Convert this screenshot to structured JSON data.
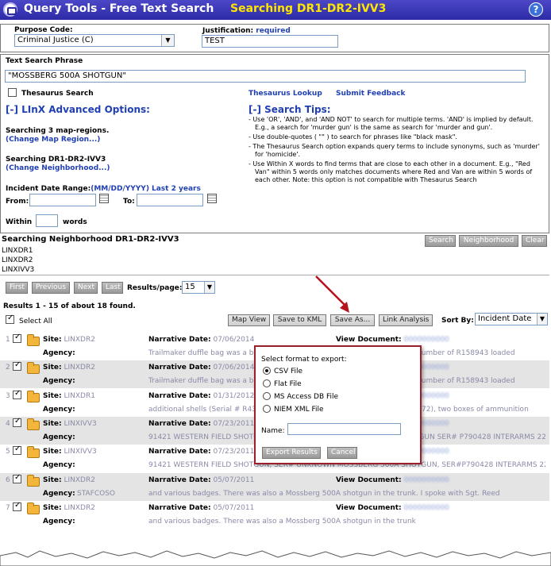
{
  "window": {
    "title": "Query Tools - Free Text Search",
    "subtitle": "Searching DR1-DR2-IVV3",
    "help": "?"
  },
  "form": {
    "purpose_label": "Purpose Code:",
    "purpose_value": "Criminal Justice (C)",
    "justification_label": "Justification:",
    "justification_required": "required",
    "justification_value": "TEST",
    "phrase_label": "Text Search Phrase",
    "phrase_value": "\"MOSSBERG 500A SHOTGUN\"",
    "thesaurus_label": "Thesaurus Search",
    "thesaurus_lookup": "Thesaurus Lookup",
    "submit_feedback": "Submit Feedback",
    "advanced_heading": "[-] LInX Advanced Options:",
    "tips_heading": "[-] Search Tips:",
    "map_regions_text": "Searching 3 map-regions.",
    "change_map_region": "(Change Map Region...)",
    "neighborhood_text": "Searching DR1-DR2-IVV3",
    "change_neighborhood": "(Change Neighborhood...)",
    "date_range_label": "Incident Date Range:",
    "date_format": "(MM/DD/YYYY)",
    "last_2_years": "Last 2 years",
    "from_label": "From:",
    "to_label": "To:",
    "within_label": "Within",
    "words_label": "words",
    "tips": [
      "- Use 'OR', 'AND', and 'AND NOT' to search for multiple terms. 'AND' is implied by default. E.g., a search for 'murder gun' is the same as search for 'murder and gun'.",
      "- Use double-quotes ( \"\" ) to search for phrases like \"black mask\".",
      "- The Thesaurus Search option expands query terms to include synonyms, such as 'murder' for 'homicide'.",
      "- Use Within X words to find terms that are close to each other in a document. E.g., \"Red Van\" within 5 words only matches documents where Red and Van are within 5 words of each other. Note: this option is not compatible with Thesaurus Search"
    ]
  },
  "neighborhood": {
    "heading": "Searching Neighborhood DR1-DR2-IVV3",
    "items": [
      "LINXDR1",
      "LINXDR2",
      "LINXIVV3"
    ],
    "search_btn": "Search",
    "neighborhood_btn": "Neighborhood",
    "clear_btn": "Clear"
  },
  "paging": {
    "first": "First",
    "previous": "Previous",
    "next": "Next",
    "last": "Last",
    "results_per_page_label": "Results/page:",
    "results_per_page": "15",
    "summary": "Results 1 - 15 of about 18 found.",
    "select_all": "Select All",
    "map_view": "Map View",
    "save_kml": "Save to KML",
    "save_as": "Save As...",
    "link_analysis": "Link Analysis",
    "sort_by_label": "Sort By:",
    "sort_by_value": "Incident Date"
  },
  "results": [
    {
      "num": "1",
      "site": "LINXDR2",
      "date": "07/06/2014",
      "agency": "",
      "narrative": "Trailmaker duffle bag was a black Mossberg 500A shotgun bearing a serial number of R158943 loaded"
    },
    {
      "num": "2",
      "site": "LINXDR2",
      "date": "07/06/2014",
      "agency": "",
      "narrative": "Trailmaker duffle bag was a black Mossberg 500A shotgun bearing a serial number of R158943 loaded"
    },
    {
      "num": "3",
      "site": "LINXDR1",
      "date": "01/31/2012",
      "agency": "",
      "narrative": "additional shells (Serial # R432515 Mossberg 500A shotgun (Serial # T168272), two boxes of ammunition"
    },
    {
      "num": "4",
      "site": "LINXIVV3",
      "date": "07/23/2011",
      "agency": "",
      "narrative": "91421 WESTERN FIELD SHOTGUN SER# UNKNOWN MOSSBERG 500A SHOTGUN SER# P790428 INTERARMS 22 RIFLE S# 329547 (FOUND"
    },
    {
      "num": "5",
      "site": "LINXIVV3",
      "date": "07/23/2011",
      "agency": "",
      "narrative": "91421 WESTERN FIELD SHOTGUN, SER# UNKNOWN MOSSBERG 500A SHOTGUN, SER#P790428 INTERARMS 22 RIFLE, SER#329547"
    },
    {
      "num": "6",
      "site": "LINXDR2",
      "date": "05/07/2011",
      "agency": "STAFCOSO",
      "narrative": "and various badges. There was also a Mossberg 500A shotgun in the trunk. I spoke with Sgt. Reed"
    },
    {
      "num": "7",
      "site": "LINXDR2",
      "date": "05/07/2011",
      "agency": "",
      "narrative": "and various badges. There was also a Mossberg 500A shotgun in the trunk"
    }
  ],
  "row_labels": {
    "site": "Site:",
    "agency": "Agency:",
    "narrative_date": "Narrative Date:",
    "view_document": "View Document:"
  },
  "export_dialog": {
    "title": "Select format to export:",
    "options": [
      "CSV File",
      "Flat File",
      "MS Access DB File",
      "NIEM XML File"
    ],
    "selected": "CSV File",
    "name_label": "Name:",
    "export_btn": "Export Results",
    "cancel_btn": "Cancel"
  },
  "colors": {
    "title_bg": "#2d2aa6",
    "subtitle": "#ffe600",
    "link": "#1f3fb3",
    "dialog_border": "#9b1e2c",
    "annotation_arrow": "#b5121b"
  }
}
